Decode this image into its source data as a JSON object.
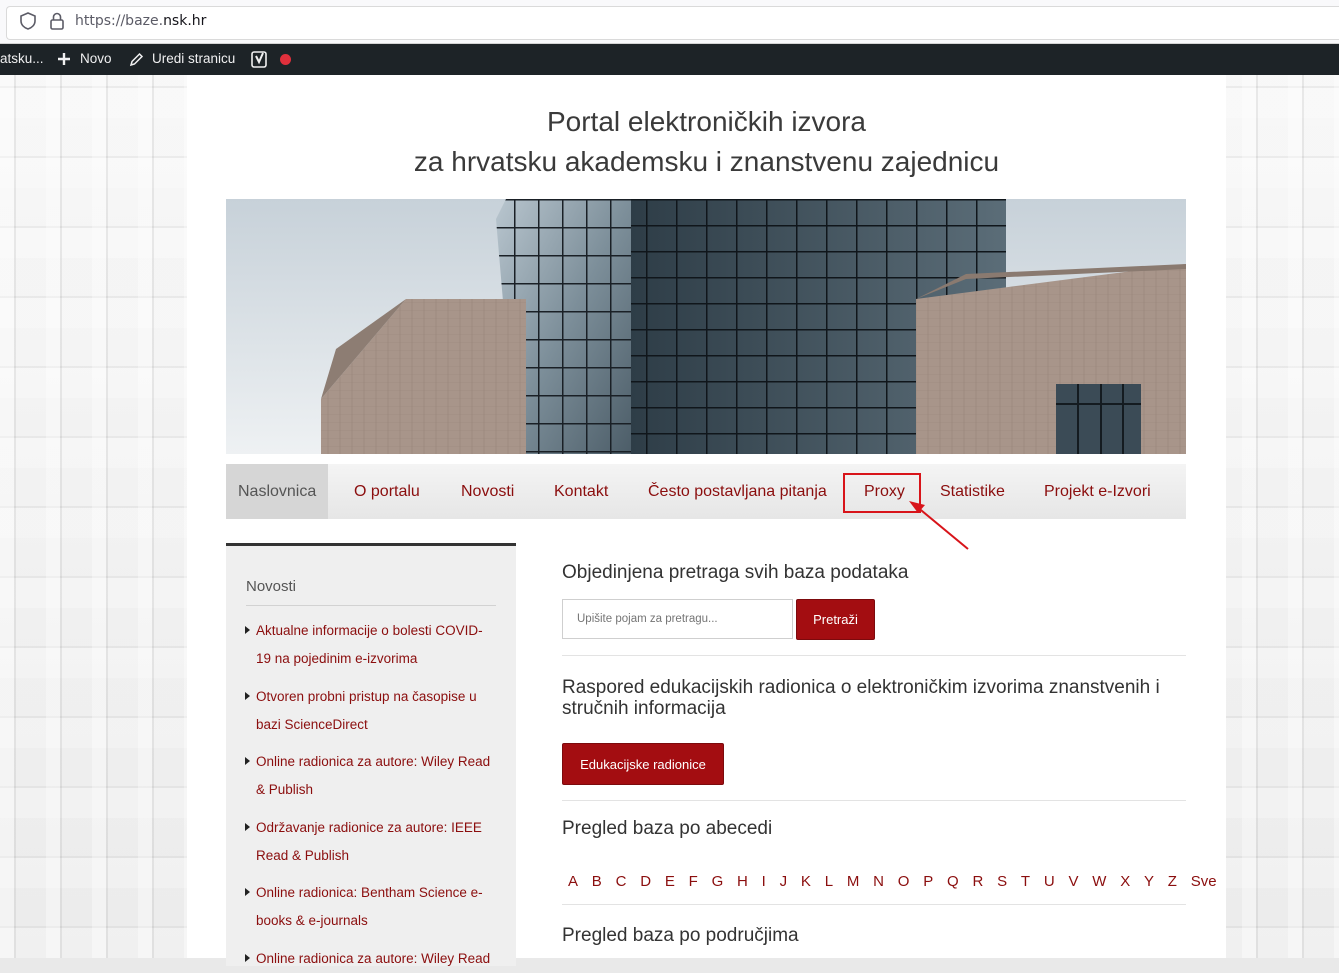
{
  "browser": {
    "url_prefix": "https://baze.",
    "url_domain": "nsk.hr"
  },
  "admin_bar": {
    "site_label": "atsku...",
    "new_label": "Novo",
    "edit_label": "Uredi stranicu"
  },
  "site": {
    "title_line1": "Portal elektroničkih izvora",
    "title_line2": "za hrvatsku akademsku i znanstvenu zajednicu"
  },
  "nav": {
    "items": [
      {
        "label": "Naslovnica"
      },
      {
        "label": "O portalu"
      },
      {
        "label": "Novosti"
      },
      {
        "label": "Kontakt"
      },
      {
        "label": "Često postavljana pitanja"
      },
      {
        "label": "Proxy"
      },
      {
        "label": "Statistike"
      },
      {
        "label": "Projekt e-Izvori"
      }
    ]
  },
  "sidebar": {
    "title": "Novosti",
    "items": [
      {
        "label": "Aktualne informacije o bolesti COVID-19 na pojedinim e-izvorima"
      },
      {
        "label": "Otvoren probni pristup na časopise u bazi ScienceDirect"
      },
      {
        "label": "Online radionica za autore: Wiley Read & Publish"
      },
      {
        "label": "Održavanje radionice za autore: IEEE Read & Publish"
      },
      {
        "label": "Online radionica: Bentham Science e-books & e-journals"
      },
      {
        "label": "Online radionica za autore: Wiley Read"
      }
    ]
  },
  "main": {
    "search_heading": "Objedinjena pretraga svih baza podataka",
    "search_placeholder": "Upišite pojam za pretragu...",
    "search_button": "Pretraži",
    "workshops_heading": "Raspored edukacijskih radionica o elektroničkim izvorima znanstvenih i stručnih informacija",
    "workshops_button": "Edukacijske radionice",
    "alpha_heading": "Pregled baza po abecedi",
    "letters": [
      "A",
      "B",
      "C",
      "D",
      "E",
      "F",
      "G",
      "H",
      "I",
      "J",
      "K",
      "L",
      "M",
      "N",
      "O",
      "P",
      "Q",
      "R",
      "S",
      "T",
      "U",
      "V",
      "W",
      "X",
      "Y",
      "Z",
      "Sve"
    ],
    "areas_heading": "Pregled baza po područjima"
  },
  "colors": {
    "accent": "#a30d11",
    "link": "#8b0e0e",
    "annotation": "#d8141a",
    "admin_bar": "#1d2327"
  }
}
